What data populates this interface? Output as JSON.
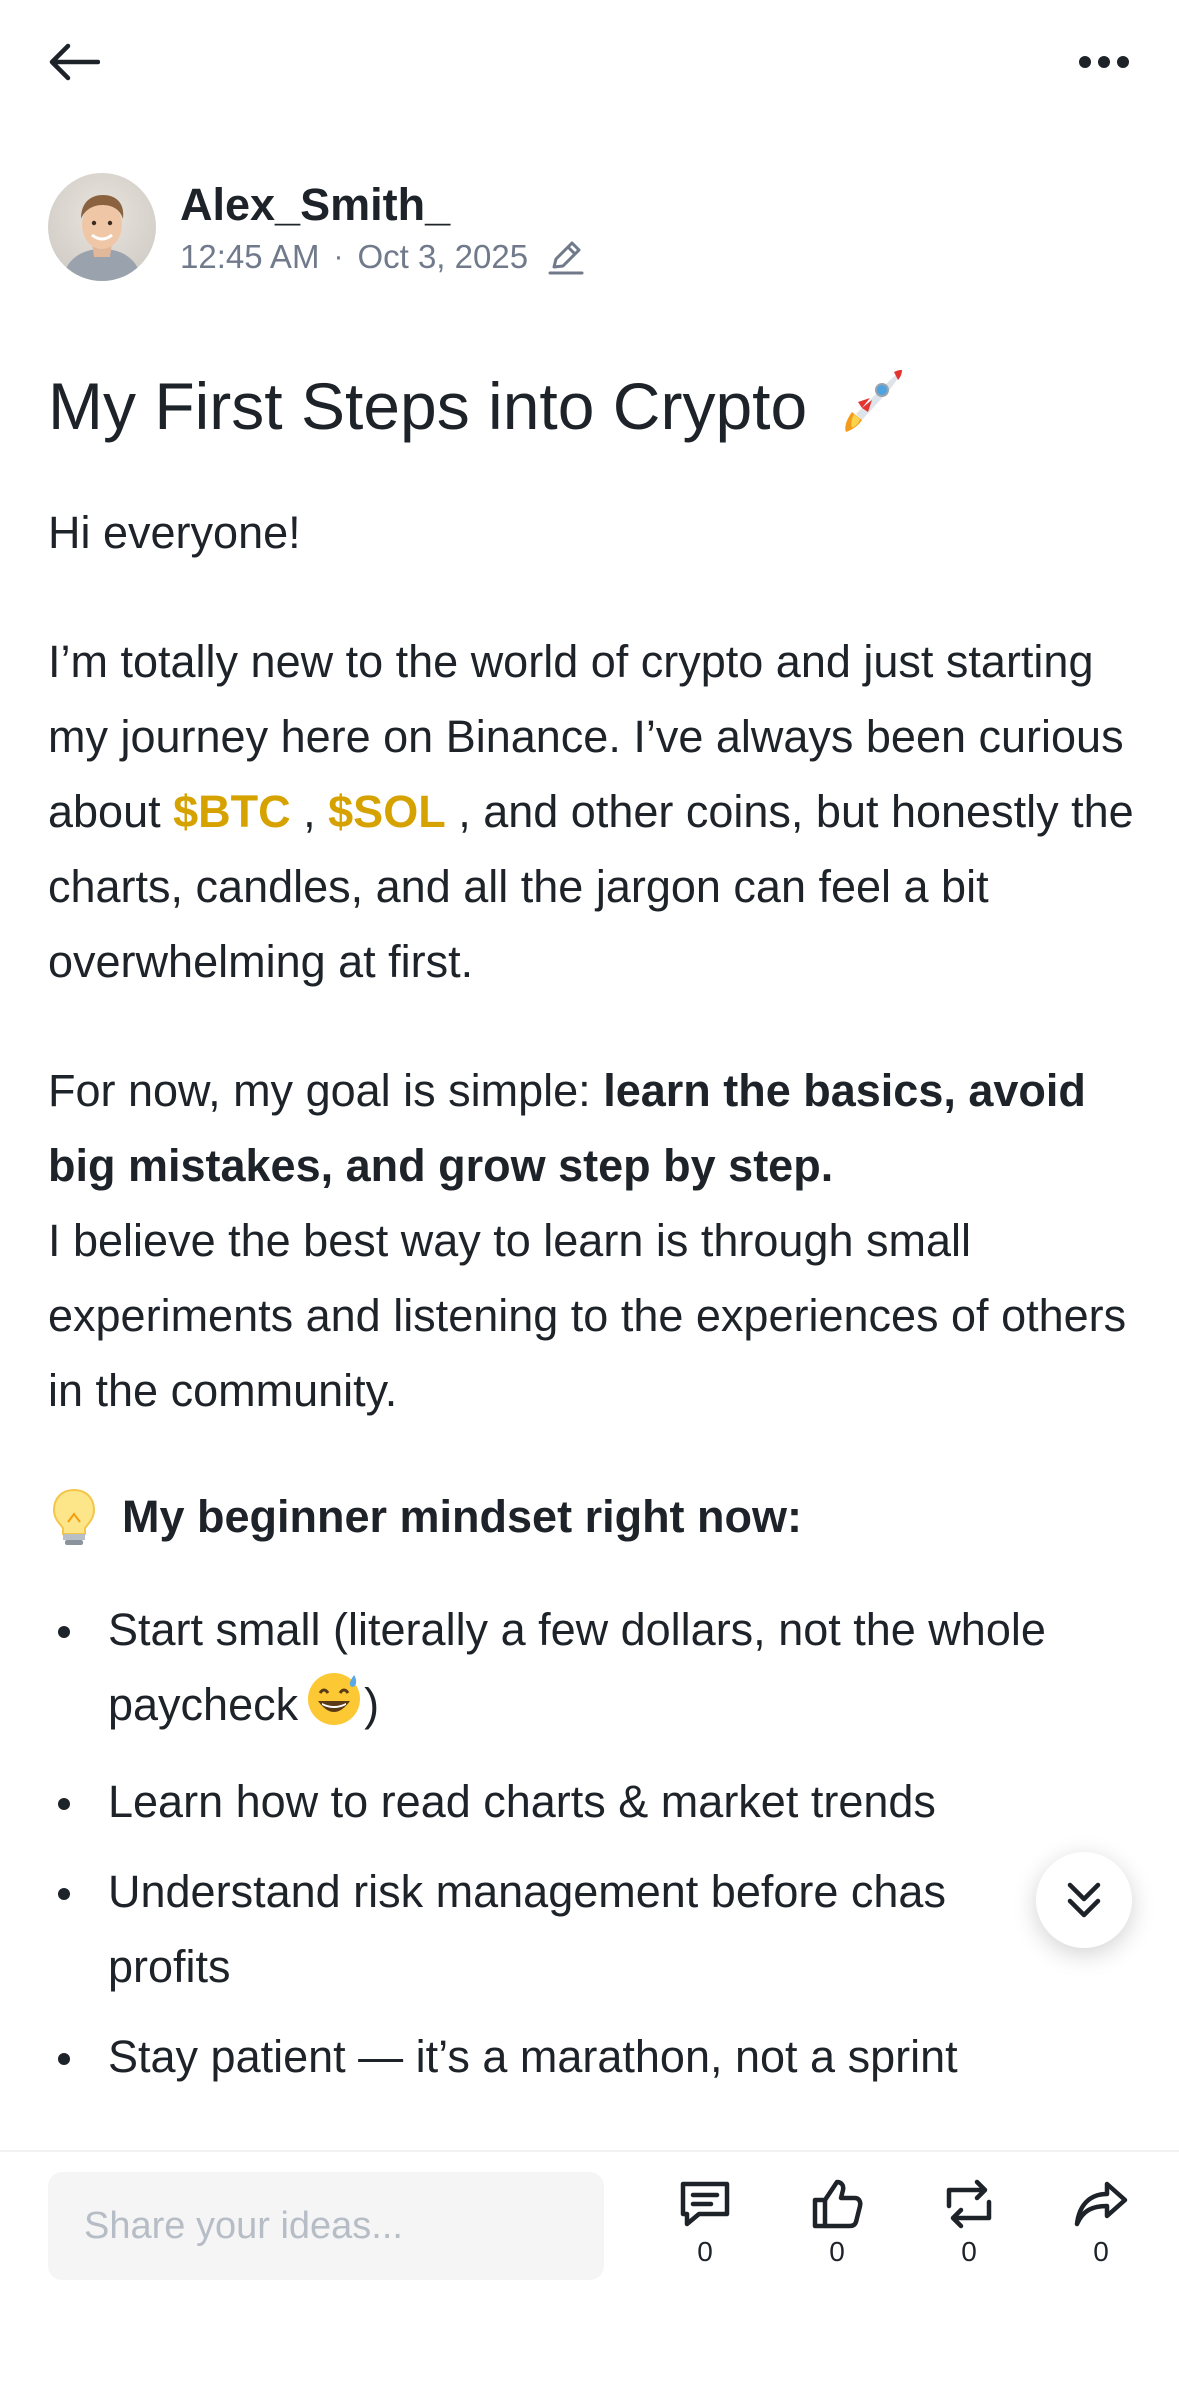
{
  "header": {
    "back_icon": "arrow-left-icon",
    "more_icon": "more-horizontal-icon"
  },
  "author": {
    "name": "Alex_Smith_",
    "time": "12:45 AM",
    "separator": "·",
    "date": "Oct 3, 2025",
    "edited_icon": "pencil-icon"
  },
  "post": {
    "title": "My First Steps into Crypto",
    "title_emoji": "rocket-icon",
    "greeting": "Hi everyone!",
    "intro_part1": "I’m totally new to the world of crypto and just starting my journey here on Binance. I’ve always been curious about ",
    "tag_btc": "$BTC",
    "comma": " , ",
    "tag_sol": "$SOL",
    "intro_part2": " , and other coins, but honestly the charts, candles, and all the jargon can feel a bit overwhelming at first.",
    "goal_prefix": "For now, my goal is simple: ",
    "goal_bold": "learn the basics, avoid big mistakes, and grow step by step.",
    "goal_rest": "I believe the best way to learn is through small experiments and listening to the experiences of others in the community.",
    "mindset_heading": "My beginner mindset right now:",
    "bullets": [
      "Start small (literally a few dollars, not the whole paycheck",
      "Learn how to read charts & market trends",
      "Understand risk management before chas",
      "Stay patient — it’s a marathon, not a sprint"
    ],
    "bullet1_suffix": ")",
    "bullet3_continued": "profits"
  },
  "bottom_bar": {
    "input_placeholder": "Share your ideas...",
    "comment_count": "0",
    "like_count": "0",
    "repost_count": "0",
    "share_count": "0"
  },
  "colors": {
    "cashtag": "#d6a200",
    "text": "#1e2329",
    "muted": "#707a8a"
  }
}
